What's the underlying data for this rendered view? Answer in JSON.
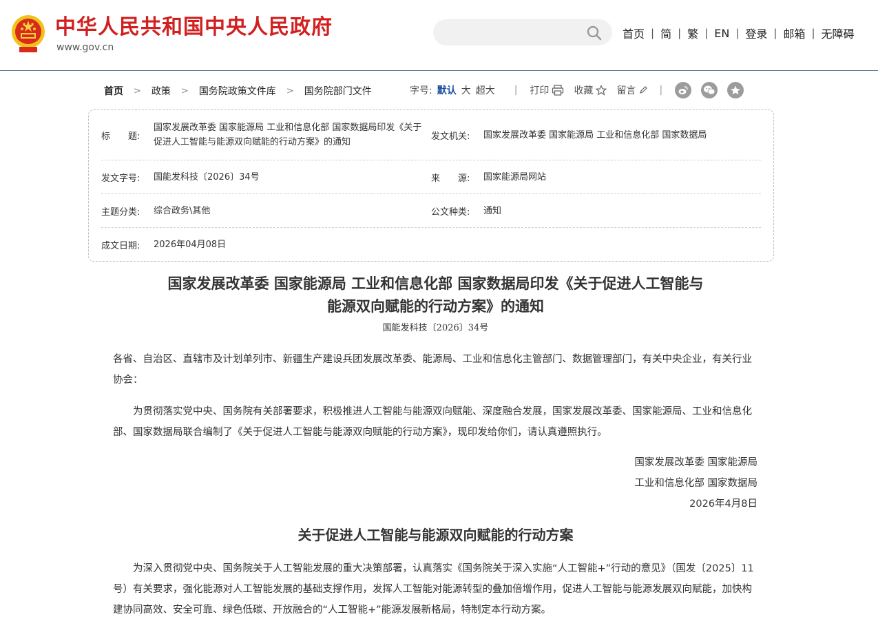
{
  "header": {
    "site_title": "中华人民共和国中央人民政府",
    "site_url": "www.gov.cn",
    "search_placeholder": "",
    "nav": [
      "首页",
      "简",
      "繁",
      "EN",
      "登录",
      "邮箱",
      "无障碍"
    ],
    "nav_separator": "|"
  },
  "breadcrumb": {
    "items": [
      "首页",
      "政策",
      "国务院政策文件库",
      "国务院部门文件"
    ],
    "separator": ">"
  },
  "toolbar": {
    "font_size_label": "字号:",
    "font_size_options": [
      "默认",
      "大",
      "超大"
    ],
    "print_label": "打印",
    "favorite_label": "收藏",
    "comment_label": "留言",
    "separator": "|"
  },
  "meta": {
    "title_label": "标　　题:",
    "title_value": "国家发展改革委 国家能源局 工业和信息化部 国家数据局印发《关于促进人工智能与能源双向赋能的行动方案》的通知",
    "issuer_label": "发文机关:",
    "issuer_value": "国家发展改革委 国家能源局 工业和信息化部 国家数据局",
    "doc_no_label": "发文字号:",
    "doc_no_value": "国能发科技〔2026〕34号",
    "source_label": "来　　源:",
    "source_value": "国家能源局网站",
    "topic_label": "主题分类:",
    "topic_value": "综合政务\\其他",
    "doc_type_label": "公文种类:",
    "doc_type_value": "通知",
    "date_label": "成文日期:",
    "date_value": "2026年04月08日"
  },
  "article": {
    "title_line1": "国家发展改革委 国家能源局 工业和信息化部 国家数据局印发《关于促进人工智能与",
    "title_line2": "能源双向赋能的行动方案》的通知",
    "doc_number": "国能发科技〔2026〕34号",
    "salutation": "各省、自治区、直辖市及计划单列市、新疆生产建设兵团发展改革委、能源局、工业和信息化主管部门、数据管理部门，有关中央企业，有关行业协会：",
    "body_para1": "为贯彻落实党中央、国务院有关部署要求，积极推进人工智能与能源双向赋能、深度融合发展，国家发展改革委、国家能源局、工业和信息化部、国家数据局联合编制了《关于促进人工智能与能源双向赋能的行动方案》，现印发给你们，请认真遵照执行。",
    "signature_line1": "国家发展改革委 国家能源局",
    "signature_line2": "工业和信息化部 国家数据局",
    "signature_date": "2026年4月8日",
    "section_title": "关于促进人工智能与能源双向赋能的行动方案",
    "body_para2": "为深入贯彻党中央、国务院关于人工智能发展的重大决策部署，认真落实《国务院关于深入实施“人工智能+”行动的意见》（国发〔2025〕11号）有关要求，强化能源对人工智能发展的基础支撑作用，发挥人工智能对能源转型的叠加倍增作用，促进人工智能与能源发展双向赋能，加快构建协同高效、安全可靠、绿色低碳、开放融合的“人工智能+”能源发展新格局，特制定本行动方案。"
  },
  "colors": {
    "brand_red": "#d21f1f",
    "active_blue": "#1c4fa3",
    "header_rule": "#5a6f86"
  }
}
